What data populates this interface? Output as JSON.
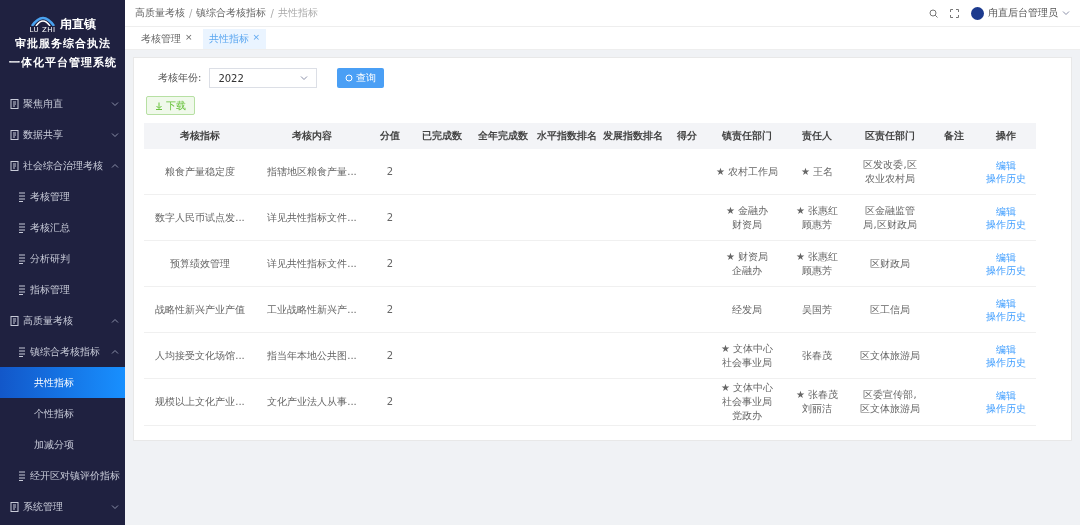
{
  "sidebar": {
    "logo_text": "LU ZHI",
    "town": "甪直镇",
    "title_lines": [
      "审批服务综合执法",
      "一体化平台管理系统"
    ],
    "items": [
      {
        "label": "聚焦甪直",
        "kind": "group",
        "expanded": false,
        "selected": false
      },
      {
        "label": "数据共享",
        "kind": "group",
        "expanded": false,
        "selected": false
      },
      {
        "label": "社会综合治理考核",
        "kind": "group",
        "expanded": true,
        "selected": false,
        "children": [
          {
            "label": "考核管理",
            "kind": "page",
            "selected": false
          },
          {
            "label": "考核汇总",
            "kind": "page",
            "selected": false
          },
          {
            "label": "分析研判",
            "kind": "page",
            "selected": false
          },
          {
            "label": "指标管理",
            "kind": "page",
            "selected": false
          }
        ]
      },
      {
        "label": "高质量考核",
        "kind": "group",
        "expanded": true,
        "selected": false,
        "children": [
          {
            "label": "镇综合考核指标",
            "kind": "group",
            "expanded": true,
            "selected": false,
            "children": [
              {
                "label": "共性指标",
                "selected": true
              },
              {
                "label": "个性指标",
                "selected": false
              },
              {
                "label": "加减分项",
                "selected": false
              }
            ]
          },
          {
            "label": "经开区对镇评价指标",
            "kind": "page",
            "selected": false
          }
        ]
      },
      {
        "label": "系统管理",
        "kind": "group",
        "expanded": false,
        "selected": false
      }
    ]
  },
  "header": {
    "breadcrumb": [
      "高质量考核",
      "镇综合考核指标",
      "共性指标"
    ],
    "separator": "/",
    "user": "甪直后台管理员"
  },
  "tabs": [
    {
      "label": "考核管理",
      "close": "×",
      "selected": false
    },
    {
      "label": "共性指标",
      "close": "×",
      "selected": true
    }
  ],
  "filter": {
    "label": "考核年份:",
    "year": "2022",
    "query_button": "查询",
    "download_button": "下载"
  },
  "table": {
    "columns": [
      "考核指标",
      "考核内容",
      "分值",
      "已完成数",
      "全年完成数",
      "水平指数排名",
      "发展指数排名",
      "得分",
      "镇责任部门",
      "责任人",
      "区责任部门",
      "备注",
      "操作"
    ],
    "rows": [
      {
        "indicator": "粮食产量稳定度",
        "content": "指辖地区粮食产量...",
        "score": "2",
        "town_dept": [
          "★ 农村工作局"
        ],
        "person": [
          "★ 王名"
        ],
        "district_dept": [
          "区发改委,区",
          "农业农村局"
        ],
        "actions": [
          "编辑",
          "操作历史"
        ]
      },
      {
        "indicator": "数字人民币试点发...",
        "content": "详见共性指标文件...",
        "score": "2",
        "town_dept": [
          "★ 金融办",
          "财资局"
        ],
        "person": [
          "★ 张惠红",
          "顾惠芳"
        ],
        "district_dept": [
          "区金融监管",
          "局,区财政局"
        ],
        "actions": [
          "编辑",
          "操作历史"
        ]
      },
      {
        "indicator": "预算绩效管理",
        "content": "详见共性指标文件...",
        "score": "2",
        "town_dept": [
          "★ 财资局",
          "企融办"
        ],
        "person": [
          "★ 张惠红",
          "顾惠芳"
        ],
        "district_dept": [
          "区财政局"
        ],
        "actions": [
          "编辑",
          "操作历史"
        ]
      },
      {
        "indicator": "战略性新兴产业产值",
        "content": "工业战略性新兴产...",
        "score": "2",
        "town_dept": [
          "经发局"
        ],
        "person": [
          "吴国芳"
        ],
        "district_dept": [
          "区工信局"
        ],
        "actions": [
          "编辑",
          "操作历史"
        ]
      },
      {
        "indicator": "人均接受文化场馆...",
        "content": "指当年本地公共图...",
        "score": "2",
        "town_dept": [
          "★ 文体中心",
          "社会事业局"
        ],
        "person": [
          "张春茂"
        ],
        "district_dept": [
          "区文体旅游局"
        ],
        "actions": [
          "编辑",
          "操作历史"
        ]
      },
      {
        "indicator": "规模以上文化产业...",
        "content": "文化产业法人从事...",
        "score": "2",
        "town_dept": [
          "★ 文体中心",
          "社会事业局",
          "党政办"
        ],
        "person": [
          "★ 张春茂",
          "刘丽洁"
        ],
        "district_dept": [
          "区委宣传部,",
          "区文体旅游局"
        ],
        "actions": [
          "编辑",
          "操作历史"
        ]
      }
    ]
  }
}
